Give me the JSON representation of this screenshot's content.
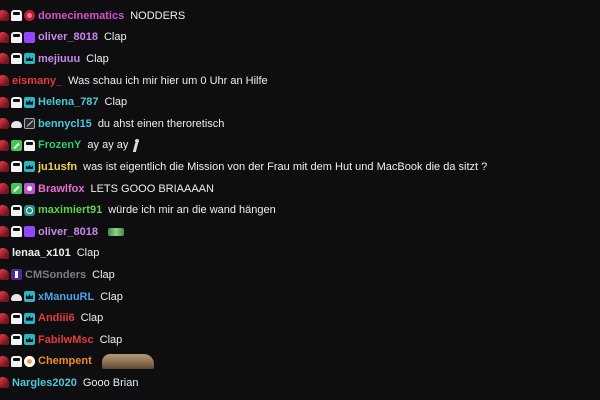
{
  "messages": [
    {
      "user": "domecinematics",
      "color": "#d64fd1",
      "text": "NODDERS",
      "badges": [
        "sub-icon",
        "hat-icon",
        "heart-icon"
      ],
      "emote": ""
    },
    {
      "user": "oliver_8018",
      "color": "#c887ee",
      "text": "Clap",
      "badges": [
        "sub-icon",
        "hat-icon",
        "prime-gem-icon"
      ],
      "emote": ""
    },
    {
      "user": "mejiuuu",
      "color": "#c887ee",
      "text": "Clap",
      "badges": [
        "sub-icon",
        "hat-icon",
        "crown-icon"
      ],
      "emote": ""
    },
    {
      "user": "eismany_",
      "color": "#e23d3d",
      "text": "Was schau ich mir hier um 0 Uhr an Hilfe",
      "badges": [
        "sub-icon"
      ],
      "emote": ""
    },
    {
      "user": "Helena_787",
      "color": "#4fc8d8",
      "text": "Clap",
      "badges": [
        "sub-icon",
        "hat-icon",
        "crown-icon"
      ],
      "emote": ""
    },
    {
      "user": "bennycl15",
      "color": "#4fc8d8",
      "text": "du ahst einen theroretisch",
      "badges": [
        "sub-icon",
        "cloud-icon",
        "no-audio-icon"
      ],
      "emote": ""
    },
    {
      "user": "FrozenY",
      "color": "#2ecc71",
      "text": "ay ay ay",
      "badges": [
        "sub-icon",
        "pencil-icon",
        "hat-icon"
      ],
      "emote": "walk-emote"
    },
    {
      "user": "ju1usfn",
      "color": "#efd45a",
      "text": "was ist eigentlich die Mission von der Frau mit dem Hut und MacBook die da sitzt ?",
      "badges": [
        "sub-icon",
        "hat-icon",
        "crown-icon"
      ],
      "emote": ""
    },
    {
      "user": "Brawlfox",
      "color": "#e96dd0",
      "text": "LETS GOOO BRIAAAAN",
      "badges": [
        "sub-icon",
        "pencil-icon",
        "heart-pink-icon"
      ],
      "emote": ""
    },
    {
      "user": "maximiert91",
      "color": "#5fd34a",
      "text": "würde ich mir an die wand hängen",
      "badges": [
        "sub-icon",
        "hat-icon",
        "ring-icon"
      ],
      "emote": ""
    },
    {
      "user": "oliver_8018",
      "color": "#c887ee",
      "text": "",
      "badges": [
        "sub-icon",
        "hat-icon",
        "prime-gem-icon"
      ],
      "emote": "small-emote"
    },
    {
      "user": "lenaa_x101",
      "color": "#efeff1",
      "text": "Clap",
      "badges": [
        "sub-icon"
      ],
      "emote": ""
    },
    {
      "user": "CMSonders",
      "color": "#7d7d86",
      "text": "Clap",
      "badges": [
        "sub-icon",
        "figure-icon"
      ],
      "emote": ""
    },
    {
      "user": "xManuuRL",
      "color": "#4aa3e8",
      "text": "Clap",
      "badges": [
        "sub-icon",
        "cloud-icon",
        "crown-icon"
      ],
      "emote": ""
    },
    {
      "user": "Andiii6",
      "color": "#e23d3d",
      "text": "Clap",
      "badges": [
        "sub-icon",
        "hat-icon",
        "crown-icon"
      ],
      "emote": ""
    },
    {
      "user": "FabilwMsc",
      "color": "#e23d3d",
      "text": "Clap",
      "badges": [
        "sub-icon",
        "hat-icon",
        "crown-icon"
      ],
      "emote": ""
    },
    {
      "user": "Chempent",
      "color": "#f08c2a",
      "text": "",
      "badges": [
        "sub-icon",
        "hat-icon",
        "orange-dot-icon"
      ],
      "emote": "big-emote"
    },
    {
      "user": "Nargles2020",
      "color": "#4fc8d8",
      "text": "Gooo Brian",
      "badges": [
        "sub-icon"
      ],
      "emote": ""
    }
  ]
}
